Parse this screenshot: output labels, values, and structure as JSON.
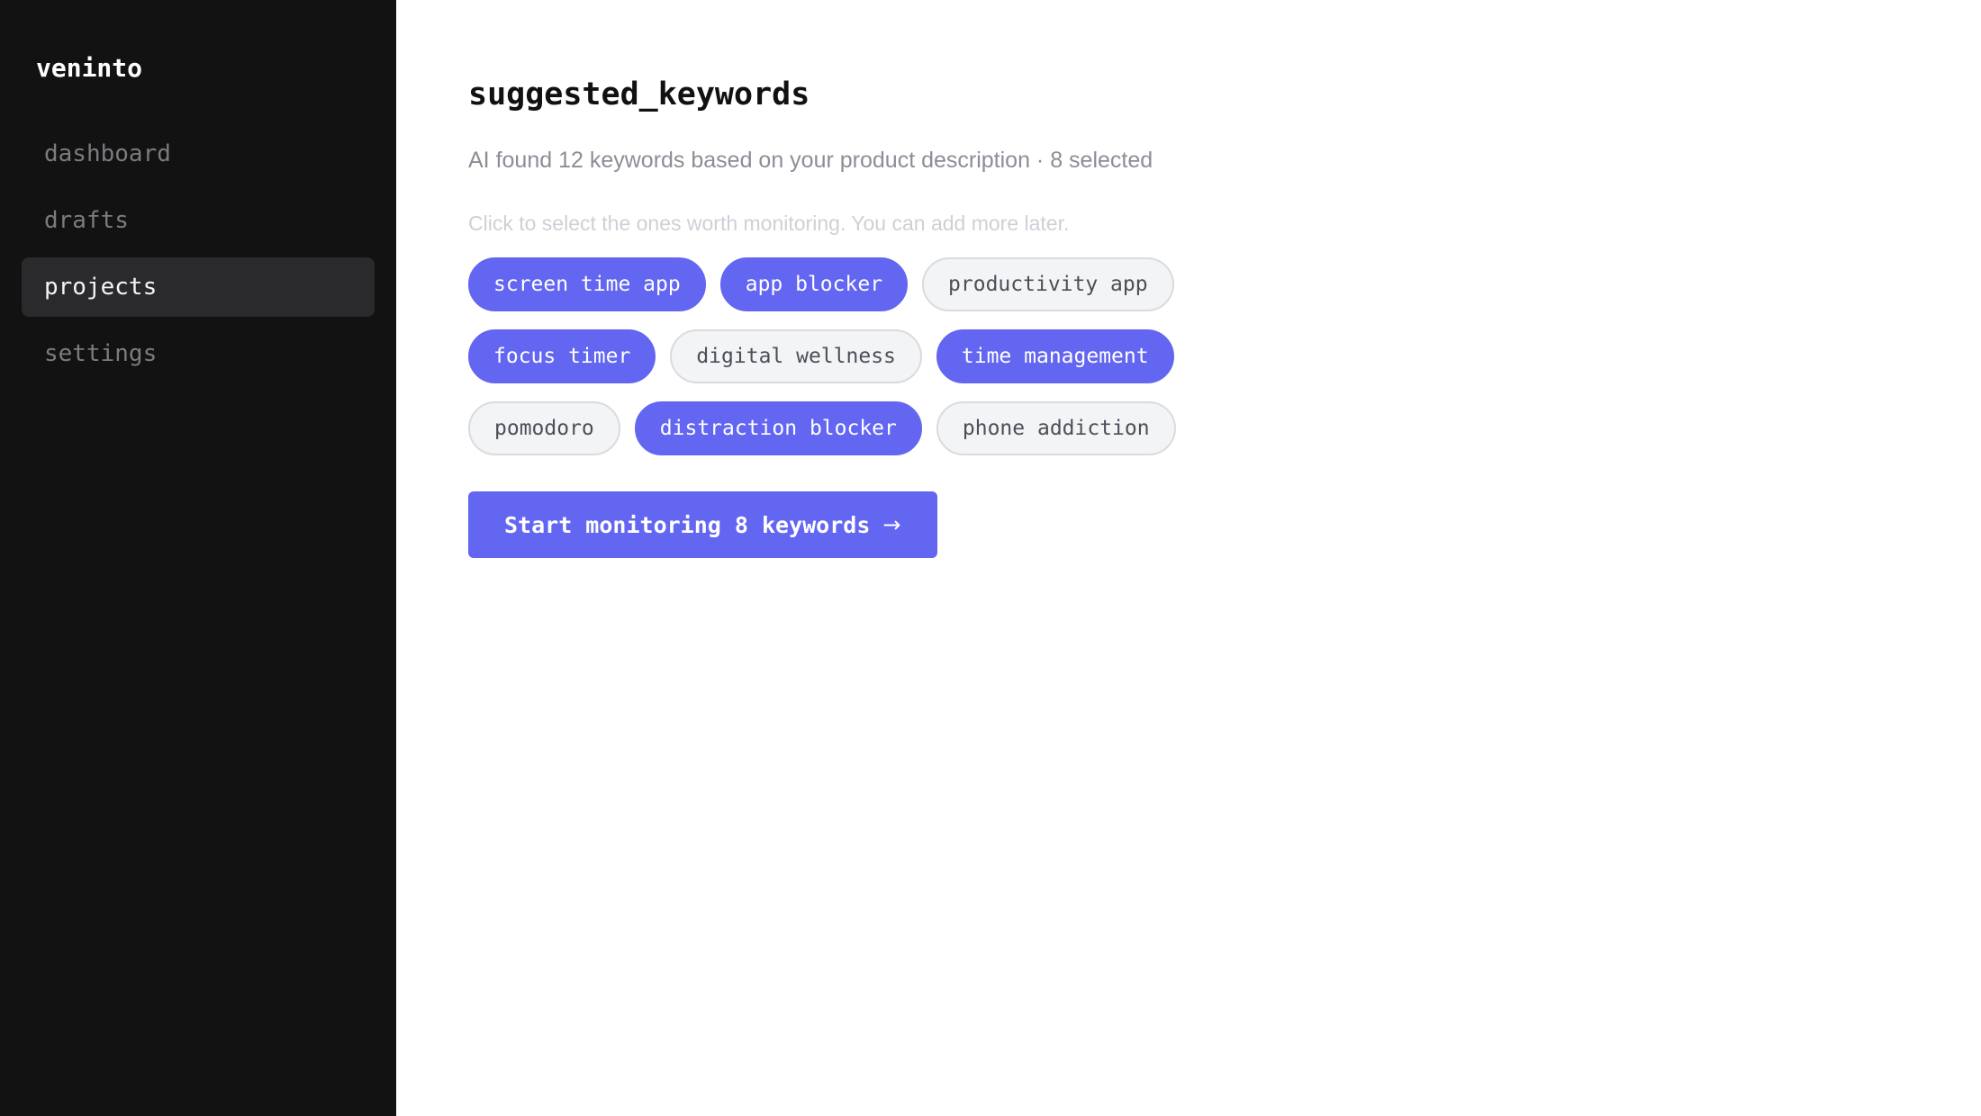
{
  "app": {
    "brand": "veninto"
  },
  "sidebar": {
    "items": [
      {
        "label": "dashboard",
        "active": false
      },
      {
        "label": "drafts",
        "active": false
      },
      {
        "label": "projects",
        "active": true
      },
      {
        "label": "settings",
        "active": false
      }
    ]
  },
  "main": {
    "title": "suggested_keywords",
    "subtitle": "AI found 12 keywords based on your product description · 8 selected",
    "hint": "Click to select the ones worth monitoring. You can add more later.",
    "keywords": [
      {
        "label": "screen time app",
        "selected": true
      },
      {
        "label": "app blocker",
        "selected": true
      },
      {
        "label": "productivity app",
        "selected": false
      },
      {
        "label": "focus timer",
        "selected": true
      },
      {
        "label": "digital wellness",
        "selected": false
      },
      {
        "label": "time management",
        "selected": true
      },
      {
        "label": "pomodoro",
        "selected": false
      },
      {
        "label": "distraction blocker",
        "selected": true
      },
      {
        "label": "phone addiction",
        "selected": false
      }
    ],
    "cta": {
      "label": "Start monitoring 8 keywords",
      "icon": "arrow-right-icon",
      "arrow": "→"
    }
  },
  "colors": {
    "sidebar_bg": "#121212",
    "accent": "#6366f1",
    "chip_unselected_bg": "#f3f4f6",
    "chip_unselected_border": "#d9dbe0"
  }
}
